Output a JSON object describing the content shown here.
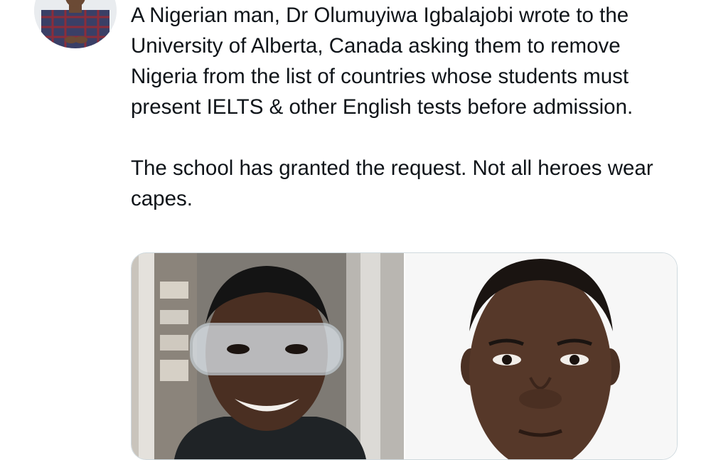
{
  "tweet": {
    "text_paragraph_1": "A Nigerian man, Dr Olumuyiwa Igbalajobi wrote to the University of Alberta, Canada asking them to remove Nigeria from the list of countries whose students must present IELTS & other English tests before admission.",
    "text_paragraph_2": "The school has granted the request. Not all heroes wear capes."
  },
  "colors": {
    "text": "#0f1419",
    "media_border": "#cfd9de",
    "background": "#ffffff"
  },
  "icons": {
    "avatar": "profile-photo"
  }
}
